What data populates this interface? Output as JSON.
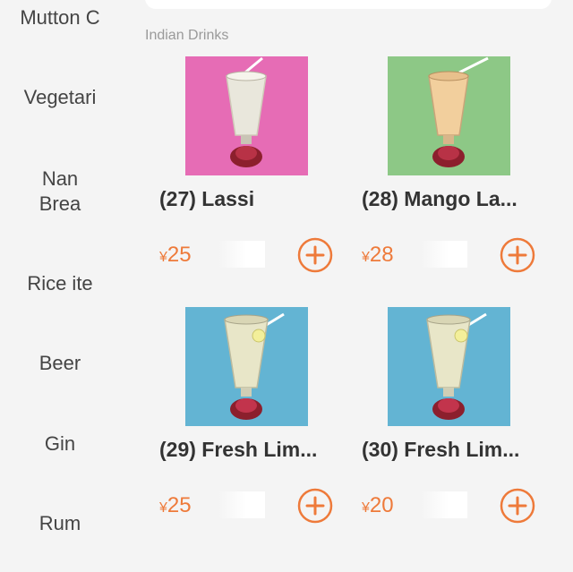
{
  "sidebar": {
    "items": [
      {
        "label": "Mutton C"
      },
      {
        "label": "Vegetari"
      },
      {
        "label": "Nan Brea"
      },
      {
        "label": "Rice ite"
      },
      {
        "label": "Beer"
      },
      {
        "label": "Gin"
      },
      {
        "label": "Rum"
      }
    ]
  },
  "section": {
    "title": "Indian Drinks"
  },
  "products": [
    {
      "name": "(27) Lassi",
      "currency": "¥",
      "price": "25",
      "bg": "#e66cb5",
      "drink": "#e9e7dc",
      "icon": "lassi-glass-icon"
    },
    {
      "name": "(28) Mango La...",
      "currency": "¥",
      "price": "28",
      "bg": "#8dc886",
      "drink": "#f2cf9d",
      "icon": "mango-lassi-glass-icon"
    },
    {
      "name": "(29) Fresh Lim...",
      "currency": "¥",
      "price": "25",
      "bg": "#63b4d3",
      "drink": "#e8e6c8",
      "icon": "fresh-lime-glass-icon"
    },
    {
      "name": "(30) Fresh Lim...",
      "currency": "¥",
      "price": "20",
      "bg": "#63b4d3",
      "drink": "#e8e6c8",
      "icon": "fresh-lime-glass-icon"
    }
  ],
  "colors": {
    "accent": "#ee7a3a",
    "background": "#f4f4f4",
    "text": "#333333"
  }
}
